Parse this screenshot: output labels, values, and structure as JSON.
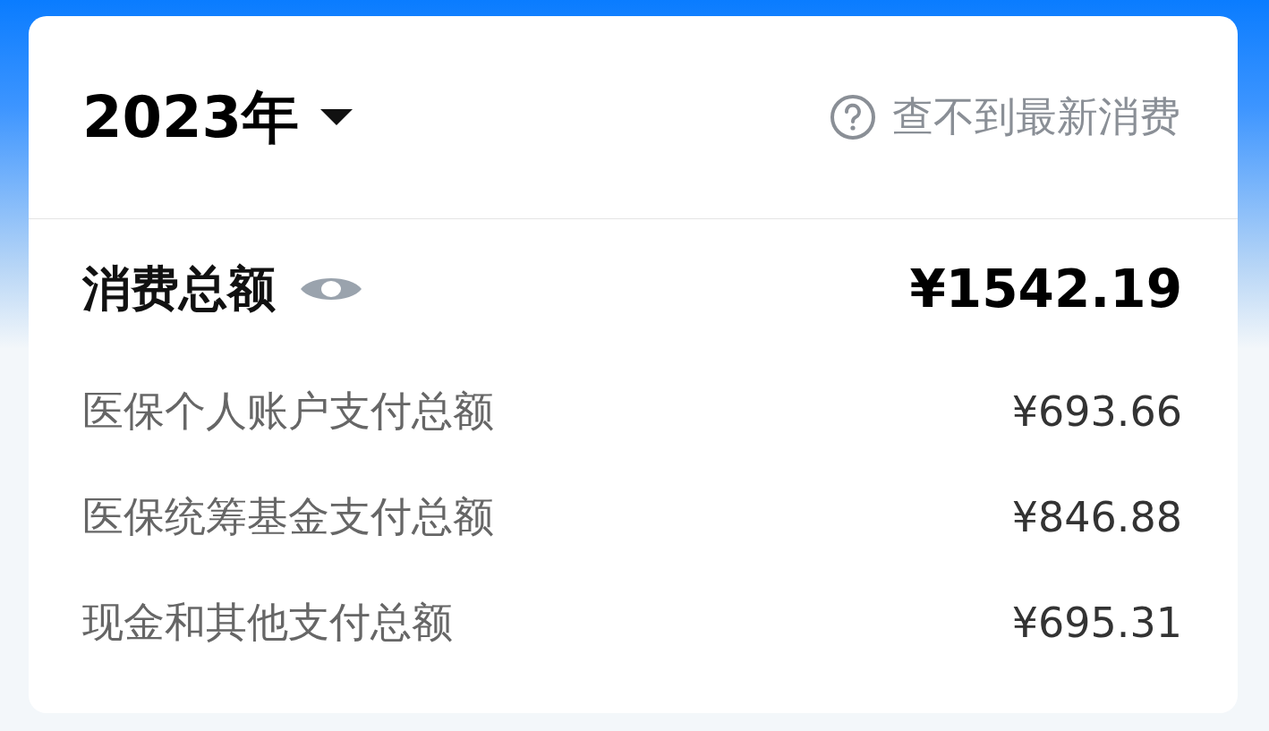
{
  "header": {
    "year": "2023年",
    "help_link": "查不到最新消费"
  },
  "summary": {
    "label": "消费总额",
    "amount": "¥1542.19"
  },
  "items": [
    {
      "label": "医保个人账户支付总额",
      "amount": "¥693.66"
    },
    {
      "label": "医保统筹基金支付总额",
      "amount": "¥846.88"
    },
    {
      "label": "现金和其他支付总额",
      "amount": "¥695.31"
    }
  ]
}
